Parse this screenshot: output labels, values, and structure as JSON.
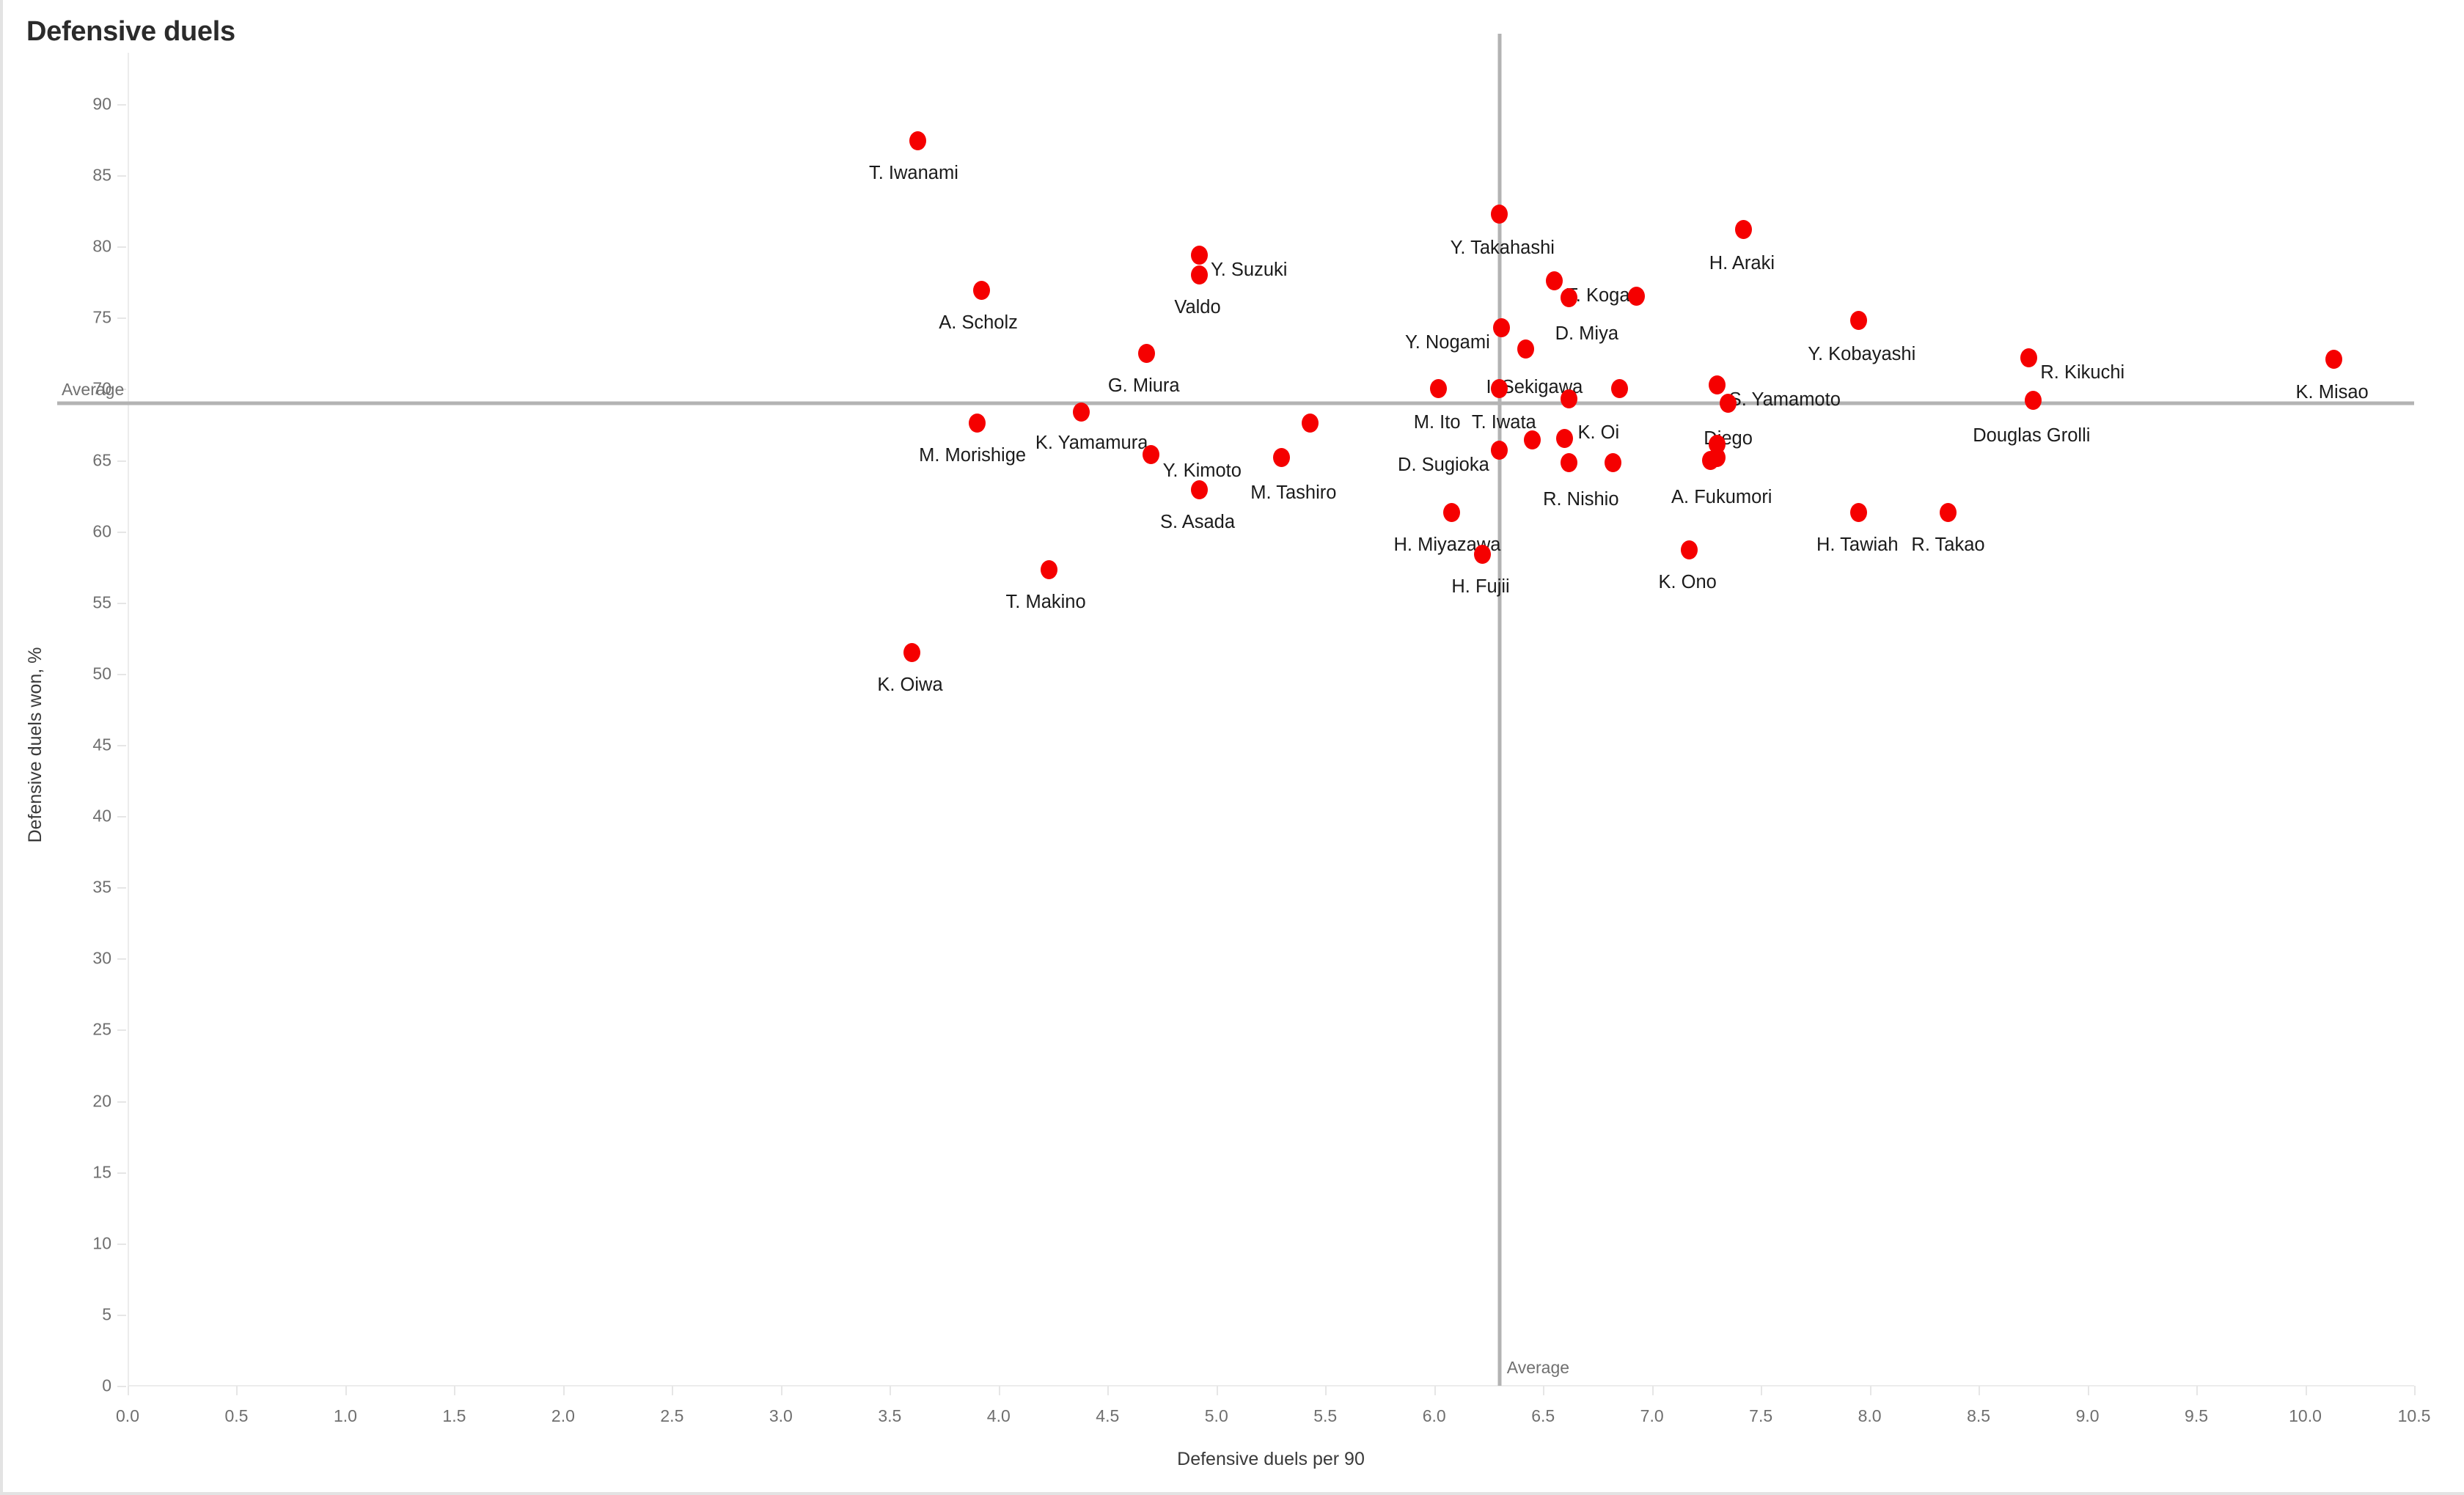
{
  "chart_data": {
    "type": "scatter",
    "title": "Defensive duels",
    "xlabel": "Defensive duels per 90",
    "ylabel": "Defensive duels won, %",
    "xlim": [
      0.0,
      10.5
    ],
    "ylim": [
      0,
      90
    ],
    "xticks": [
      "0.0",
      "0.5",
      "1.0",
      "1.5",
      "2.0",
      "2.5",
      "3.0",
      "3.5",
      "4.0",
      "4.5",
      "5.0",
      "5.5",
      "6.0",
      "6.5",
      "7.0",
      "7.5",
      "8.0",
      "8.5",
      "9.0",
      "9.5",
      "10.0",
      "10.5"
    ],
    "xtick_values": [
      0.0,
      0.5,
      1.0,
      1.5,
      2.0,
      2.5,
      3.0,
      3.5,
      4.0,
      4.5,
      5.0,
      5.5,
      6.0,
      6.5,
      7.0,
      7.5,
      8.0,
      8.5,
      9.0,
      9.5,
      10.0,
      10.5
    ],
    "yticks": [
      "0",
      "5",
      "10",
      "15",
      "20",
      "25",
      "30",
      "35",
      "40",
      "45",
      "50",
      "55",
      "60",
      "65",
      "70",
      "75",
      "80",
      "85",
      "90"
    ],
    "ytick_values": [
      0,
      5,
      10,
      15,
      20,
      25,
      30,
      35,
      40,
      45,
      50,
      55,
      60,
      65,
      70,
      75,
      80,
      85,
      90
    ],
    "grid": false,
    "legend": null,
    "point_color": "#f50000",
    "reference_lines": [
      {
        "orientation": "horizontal",
        "label": "Average",
        "value": 69.0,
        "color": "#b3b3b3"
      },
      {
        "orientation": "vertical",
        "label": "Average",
        "value": 6.3,
        "color": "#b3b3b3"
      }
    ],
    "points": [
      {
        "name": "T. Iwanami",
        "x": 3.63,
        "y": 87.4,
        "label_pos": "center",
        "label_dx": -6,
        "label_dy": 32
      },
      {
        "name": "A. Scholz",
        "x": 3.92,
        "y": 76.9,
        "label_pos": "center",
        "label_dx": -4,
        "label_dy": 32
      },
      {
        "name": "Y. Suzuki",
        "x": 4.92,
        "y": 79.4,
        "label_pos": "right",
        "label_dx": 16,
        "label_dy": 8
      },
      {
        "name": "Valdo",
        "x": 4.92,
        "y": 78.0,
        "label_pos": "center",
        "label_dx": -2,
        "label_dy": 32
      },
      {
        "name": "Y. Takahashi",
        "x": 6.3,
        "y": 82.3,
        "label_pos": "center",
        "label_dx": 4,
        "label_dy": 34
      },
      {
        "name": "H. Araki",
        "x": 7.42,
        "y": 81.2,
        "label_pos": "center",
        "label_dx": -2,
        "label_dy": 34
      },
      {
        "name": "T. Koga",
        "x": 6.55,
        "y": 77.6,
        "label_pos": "right",
        "label_dx": 17,
        "label_dy": 8
      },
      {
        "name": "D. Miya",
        "x": 6.62,
        "y": 76.4,
        "label_pos": "center",
        "label_dx": 24,
        "label_dy": 37
      },
      {
        "name": "Unlabeled-1",
        "x": 6.93,
        "y": 76.5,
        "label_pos": "none",
        "label_dx": 0,
        "label_dy": 0
      },
      {
        "name": "Y. Nogami",
        "x": 6.31,
        "y": 74.3,
        "label_pos": "left",
        "label_dx": -16,
        "label_dy": 8
      },
      {
        "name": "Y. Kobayashi",
        "x": 7.95,
        "y": 74.8,
        "label_pos": "center",
        "label_dx": 4,
        "label_dy": 34
      },
      {
        "name": "I. Sekigawa",
        "x": 6.42,
        "y": 72.8,
        "label_pos": "center",
        "label_dx": 12,
        "label_dy": 40
      },
      {
        "name": "G. Miura",
        "x": 4.68,
        "y": 72.5,
        "label_pos": "center",
        "label_dx": -4,
        "label_dy": 32
      },
      {
        "name": "R. Kikuchi",
        "x": 8.73,
        "y": 72.2,
        "label_pos": "right",
        "label_dx": 16,
        "label_dy": 8
      },
      {
        "name": "K. Misao",
        "x": 10.13,
        "y": 72.1,
        "label_pos": "center",
        "label_dx": -2,
        "label_dy": 33
      },
      {
        "name": "S. Yamamoto",
        "x": 7.3,
        "y": 70.3,
        "label_pos": "right",
        "label_dx": 16,
        "label_dy": 8
      },
      {
        "name": "M. Ito",
        "x": 6.02,
        "y": 70.0,
        "label_pos": "center",
        "label_dx": -2,
        "label_dy": 34
      },
      {
        "name": "T. Iwata",
        "x": 6.3,
        "y": 70.0,
        "label_pos": "center",
        "label_dx": 6,
        "label_dy": 34
      },
      {
        "name": "K. Oi",
        "x": 6.62,
        "y": 69.3,
        "label_pos": "center",
        "label_dx": 40,
        "label_dy": 34
      },
      {
        "name": "Unlabeled-2",
        "x": 6.85,
        "y": 70.0,
        "label_pos": "none",
        "label_dx": 0,
        "label_dy": 0
      },
      {
        "name": "Diego",
        "x": 7.35,
        "y": 69.0,
        "label_pos": "center",
        "label_dx": 0,
        "label_dy": 36
      },
      {
        "name": "Douglas Grolli",
        "x": 8.75,
        "y": 69.2,
        "label_pos": "center",
        "label_dx": -2,
        "label_dy": 36
      },
      {
        "name": "K. Yamamura",
        "x": 4.38,
        "y": 68.4,
        "label_pos": "center",
        "label_dx": 14,
        "label_dy": 30
      },
      {
        "name": "M. Morishige",
        "x": 3.9,
        "y": 67.6,
        "label_pos": "center",
        "label_dx": -6,
        "label_dy": 32
      },
      {
        "name": "Unlabeled-3",
        "x": 5.43,
        "y": 67.6,
        "label_pos": "none",
        "label_dx": 0,
        "label_dy": 0
      },
      {
        "name": "D. Sugioka",
        "x": 6.3,
        "y": 65.7,
        "label_pos": "left",
        "label_dx": -14,
        "label_dy": 8
      },
      {
        "name": "Y. Kimoto",
        "x": 4.7,
        "y": 65.4,
        "label_pos": "right",
        "label_dx": 16,
        "label_dy": 10
      },
      {
        "name": "M. Tashiro",
        "x": 5.3,
        "y": 65.2,
        "label_pos": "center",
        "label_dx": 16,
        "label_dy": 36
      },
      {
        "name": "Unlabeled-4",
        "x": 6.45,
        "y": 66.4,
        "label_pos": "none",
        "label_dx": 0,
        "label_dy": 0
      },
      {
        "name": "Unlabeled-5",
        "x": 6.6,
        "y": 66.5,
        "label_pos": "none",
        "label_dx": 0,
        "label_dy": 0
      },
      {
        "name": "Unlabeled-6",
        "x": 7.3,
        "y": 66.1,
        "label_pos": "none",
        "label_dx": 0,
        "label_dy": 0
      },
      {
        "name": "A. Fukumori",
        "x": 7.3,
        "y": 65.2,
        "label_pos": "center",
        "label_dx": 6,
        "label_dy": 42
      },
      {
        "name": "Unlabeled-7",
        "x": 7.27,
        "y": 65.0,
        "label_pos": "none",
        "label_dx": 0,
        "label_dy": 0
      },
      {
        "name": "R. Nishio",
        "x": 6.62,
        "y": 64.8,
        "label_pos": "center",
        "label_dx": 16,
        "label_dy": 38
      },
      {
        "name": "Unlabeled-8",
        "x": 6.82,
        "y": 64.8,
        "label_pos": "none",
        "label_dx": 0,
        "label_dy": 0
      },
      {
        "name": "S. Asada",
        "x": 4.92,
        "y": 62.9,
        "label_pos": "center",
        "label_dx": -2,
        "label_dy": 32
      },
      {
        "name": "H. Miyazawa",
        "x": 6.08,
        "y": 61.3,
        "label_pos": "center",
        "label_dx": -6,
        "label_dy": 32
      },
      {
        "name": "H. Tawiah",
        "x": 7.95,
        "y": 61.3,
        "label_pos": "center",
        "label_dx": -2,
        "label_dy": 32
      },
      {
        "name": "R. Takao",
        "x": 8.36,
        "y": 61.3,
        "label_pos": "center",
        "label_dx": 0,
        "label_dy": 32
      },
      {
        "name": "H. Fujii",
        "x": 6.22,
        "y": 58.4,
        "label_pos": "center",
        "label_dx": -2,
        "label_dy": 32
      },
      {
        "name": "K. Ono",
        "x": 7.17,
        "y": 58.7,
        "label_pos": "center",
        "label_dx": -2,
        "label_dy": 32
      },
      {
        "name": "T. Makino",
        "x": 4.23,
        "y": 57.3,
        "label_pos": "center",
        "label_dx": -4,
        "label_dy": 32
      },
      {
        "name": "K. Oiwa",
        "x": 3.6,
        "y": 51.5,
        "label_pos": "center",
        "label_dx": -2,
        "label_dy": 32
      }
    ]
  }
}
